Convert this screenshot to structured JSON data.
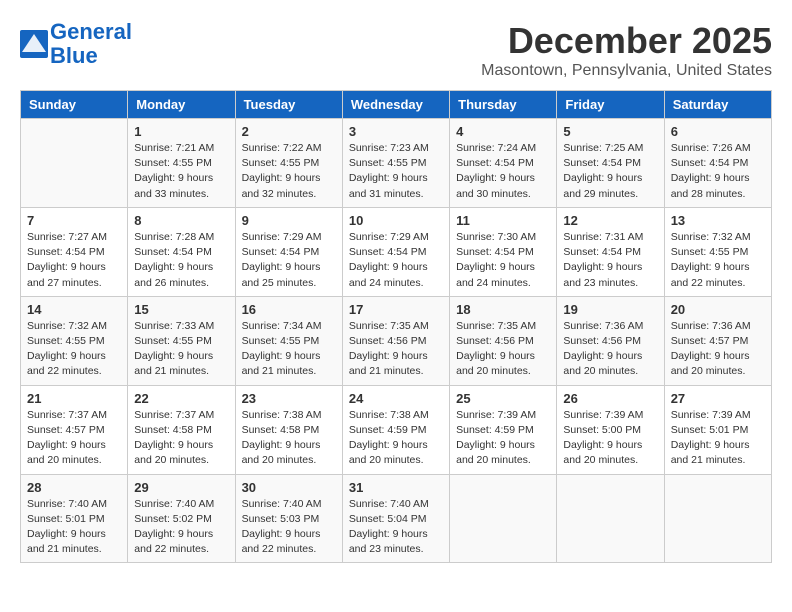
{
  "header": {
    "logo_line1": "General",
    "logo_line2": "Blue",
    "month_title": "December 2025",
    "subtitle": "Masontown, Pennsylvania, United States"
  },
  "days_of_week": [
    "Sunday",
    "Monday",
    "Tuesday",
    "Wednesday",
    "Thursday",
    "Friday",
    "Saturday"
  ],
  "weeks": [
    [
      {
        "day": "",
        "info": ""
      },
      {
        "day": "1",
        "info": "Sunrise: 7:21 AM\nSunset: 4:55 PM\nDaylight: 9 hours\nand 33 minutes."
      },
      {
        "day": "2",
        "info": "Sunrise: 7:22 AM\nSunset: 4:55 PM\nDaylight: 9 hours\nand 32 minutes."
      },
      {
        "day": "3",
        "info": "Sunrise: 7:23 AM\nSunset: 4:55 PM\nDaylight: 9 hours\nand 31 minutes."
      },
      {
        "day": "4",
        "info": "Sunrise: 7:24 AM\nSunset: 4:54 PM\nDaylight: 9 hours\nand 30 minutes."
      },
      {
        "day": "5",
        "info": "Sunrise: 7:25 AM\nSunset: 4:54 PM\nDaylight: 9 hours\nand 29 minutes."
      },
      {
        "day": "6",
        "info": "Sunrise: 7:26 AM\nSunset: 4:54 PM\nDaylight: 9 hours\nand 28 minutes."
      }
    ],
    [
      {
        "day": "7",
        "info": "Sunrise: 7:27 AM\nSunset: 4:54 PM\nDaylight: 9 hours\nand 27 minutes."
      },
      {
        "day": "8",
        "info": "Sunrise: 7:28 AM\nSunset: 4:54 PM\nDaylight: 9 hours\nand 26 minutes."
      },
      {
        "day": "9",
        "info": "Sunrise: 7:29 AM\nSunset: 4:54 PM\nDaylight: 9 hours\nand 25 minutes."
      },
      {
        "day": "10",
        "info": "Sunrise: 7:29 AM\nSunset: 4:54 PM\nDaylight: 9 hours\nand 24 minutes."
      },
      {
        "day": "11",
        "info": "Sunrise: 7:30 AM\nSunset: 4:54 PM\nDaylight: 9 hours\nand 24 minutes."
      },
      {
        "day": "12",
        "info": "Sunrise: 7:31 AM\nSunset: 4:54 PM\nDaylight: 9 hours\nand 23 minutes."
      },
      {
        "day": "13",
        "info": "Sunrise: 7:32 AM\nSunset: 4:55 PM\nDaylight: 9 hours\nand 22 minutes."
      }
    ],
    [
      {
        "day": "14",
        "info": "Sunrise: 7:32 AM\nSunset: 4:55 PM\nDaylight: 9 hours\nand 22 minutes."
      },
      {
        "day": "15",
        "info": "Sunrise: 7:33 AM\nSunset: 4:55 PM\nDaylight: 9 hours\nand 21 minutes."
      },
      {
        "day": "16",
        "info": "Sunrise: 7:34 AM\nSunset: 4:55 PM\nDaylight: 9 hours\nand 21 minutes."
      },
      {
        "day": "17",
        "info": "Sunrise: 7:35 AM\nSunset: 4:56 PM\nDaylight: 9 hours\nand 21 minutes."
      },
      {
        "day": "18",
        "info": "Sunrise: 7:35 AM\nSunset: 4:56 PM\nDaylight: 9 hours\nand 20 minutes."
      },
      {
        "day": "19",
        "info": "Sunrise: 7:36 AM\nSunset: 4:56 PM\nDaylight: 9 hours\nand 20 minutes."
      },
      {
        "day": "20",
        "info": "Sunrise: 7:36 AM\nSunset: 4:57 PM\nDaylight: 9 hours\nand 20 minutes."
      }
    ],
    [
      {
        "day": "21",
        "info": "Sunrise: 7:37 AM\nSunset: 4:57 PM\nDaylight: 9 hours\nand 20 minutes."
      },
      {
        "day": "22",
        "info": "Sunrise: 7:37 AM\nSunset: 4:58 PM\nDaylight: 9 hours\nand 20 minutes."
      },
      {
        "day": "23",
        "info": "Sunrise: 7:38 AM\nSunset: 4:58 PM\nDaylight: 9 hours\nand 20 minutes."
      },
      {
        "day": "24",
        "info": "Sunrise: 7:38 AM\nSunset: 4:59 PM\nDaylight: 9 hours\nand 20 minutes."
      },
      {
        "day": "25",
        "info": "Sunrise: 7:39 AM\nSunset: 4:59 PM\nDaylight: 9 hours\nand 20 minutes."
      },
      {
        "day": "26",
        "info": "Sunrise: 7:39 AM\nSunset: 5:00 PM\nDaylight: 9 hours\nand 20 minutes."
      },
      {
        "day": "27",
        "info": "Sunrise: 7:39 AM\nSunset: 5:01 PM\nDaylight: 9 hours\nand 21 minutes."
      }
    ],
    [
      {
        "day": "28",
        "info": "Sunrise: 7:40 AM\nSunset: 5:01 PM\nDaylight: 9 hours\nand 21 minutes."
      },
      {
        "day": "29",
        "info": "Sunrise: 7:40 AM\nSunset: 5:02 PM\nDaylight: 9 hours\nand 22 minutes."
      },
      {
        "day": "30",
        "info": "Sunrise: 7:40 AM\nSunset: 5:03 PM\nDaylight: 9 hours\nand 22 minutes."
      },
      {
        "day": "31",
        "info": "Sunrise: 7:40 AM\nSunset: 5:04 PM\nDaylight: 9 hours\nand 23 minutes."
      },
      {
        "day": "",
        "info": ""
      },
      {
        "day": "",
        "info": ""
      },
      {
        "day": "",
        "info": ""
      }
    ]
  ]
}
